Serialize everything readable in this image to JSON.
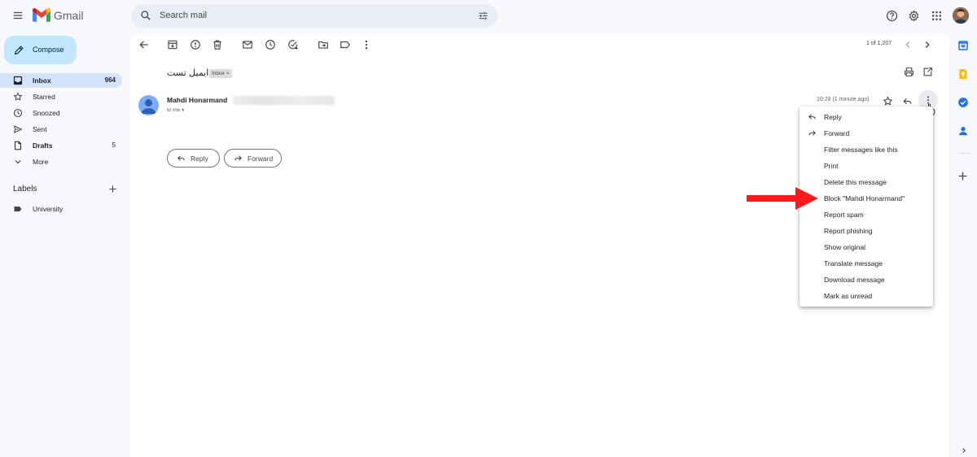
{
  "app": {
    "name": "Gmail"
  },
  "search": {
    "placeholder": "Search mail"
  },
  "sidebar": {
    "compose_label": "Compose",
    "items": [
      {
        "label": "Inbox",
        "count": "964",
        "icon": "inbox-icon"
      },
      {
        "label": "Starred",
        "count": "",
        "icon": "star-icon"
      },
      {
        "label": "Snoozed",
        "count": "",
        "icon": "clock-icon"
      },
      {
        "label": "Sent",
        "count": "",
        "icon": "send-icon"
      },
      {
        "label": "Drafts",
        "count": "5",
        "icon": "draft-icon"
      },
      {
        "label": "More",
        "count": "",
        "icon": "chevron-down-icon"
      }
    ],
    "labels_heading": "Labels",
    "labels": [
      {
        "label": "University",
        "icon": "label-icon"
      }
    ]
  },
  "toolbar": {
    "pager": "1 of 1,207"
  },
  "message": {
    "subject": "ایمیل تست",
    "chip": "Inbox",
    "chip_remove": "×",
    "sender_name": "Mahdi Honarmand",
    "to": "to me",
    "time": "10:28 (1 minute ago)",
    "reply_label": "Reply",
    "forward_label": "Forward"
  },
  "menu": {
    "items": [
      {
        "label": "Reply",
        "icon": "reply-icon"
      },
      {
        "label": "Forward",
        "icon": "forward-icon"
      },
      {
        "label": "Filter messages like this",
        "icon": ""
      },
      {
        "label": "Print",
        "icon": ""
      },
      {
        "label": "Delete this message",
        "icon": ""
      },
      {
        "label": "Block \"Mahdi Honarmand\"",
        "icon": ""
      },
      {
        "label": "Report spam",
        "icon": ""
      },
      {
        "label": "Report phishing",
        "icon": ""
      },
      {
        "label": "Show original",
        "icon": ""
      },
      {
        "label": "Translate message",
        "icon": ""
      },
      {
        "label": "Download message",
        "icon": ""
      },
      {
        "label": "Mark as unread",
        "icon": ""
      }
    ]
  },
  "colors": {
    "background": "#f6f8fc",
    "compose": "#c2e7ff",
    "active_nav": "#d3e3fd",
    "annotation_arrow": "#ff1a1a"
  }
}
